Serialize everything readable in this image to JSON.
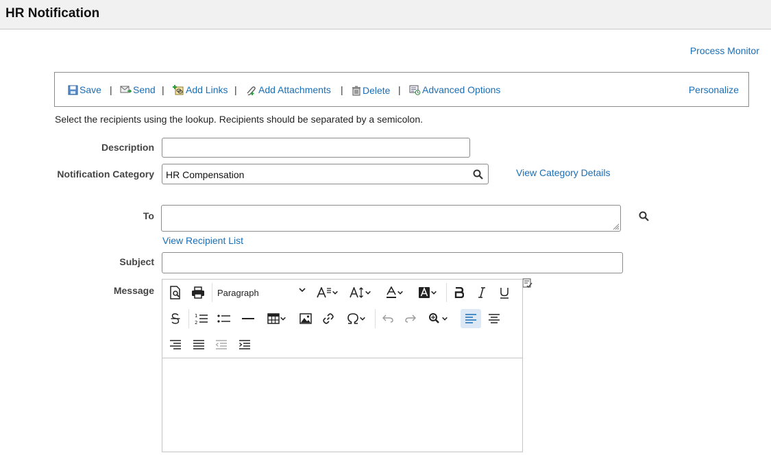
{
  "page": {
    "title": "HR Notification"
  },
  "links": {
    "process_monitor": "Process Monitor"
  },
  "toolbar": {
    "save": "Save",
    "send": "Send",
    "add_links": "Add Links",
    "add_attachments": "Add Attachments",
    "delete": "Delete",
    "advanced_options": "Advanced Options",
    "separator": "|",
    "personalize": "Personalize"
  },
  "instructions": "Select the recipients using the lookup. Recipients should be separated by a semicolon.",
  "form": {
    "description_label": "Description",
    "description_value": "",
    "category_label": "Notification Category",
    "category_value": "HR Compensation",
    "view_category_details": "View Category Details",
    "to_label": "To",
    "to_value": "",
    "view_recipient_list": "View Recipient List",
    "subject_label": "Subject",
    "subject_value": "",
    "message_label": "Message"
  },
  "editor": {
    "paragraph_format": "Paragraph",
    "body": "",
    "icons": [
      "preview-icon",
      "print-icon",
      "font-size-icon",
      "line-height-icon",
      "font-color-icon",
      "highlight-icon",
      "bold-icon",
      "italic-icon",
      "underline-icon",
      "strikethrough-icon",
      "numbered-list-icon",
      "bulleted-list-icon",
      "horizontal-line-icon",
      "table-icon",
      "image-icon",
      "link-icon",
      "special-character-icon",
      "undo-icon",
      "redo-icon",
      "find-replace-icon",
      "align-left-icon",
      "align-center-icon",
      "align-right-icon",
      "justify-icon",
      "outdent-icon",
      "indent-icon"
    ]
  }
}
